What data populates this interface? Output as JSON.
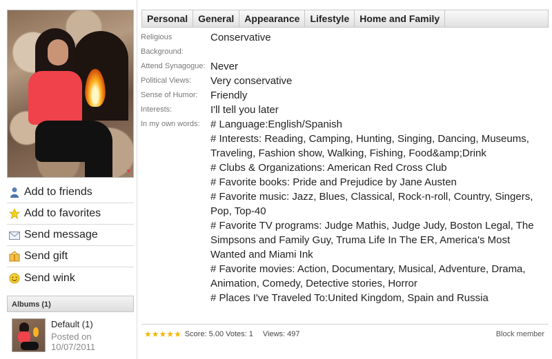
{
  "actions": [
    {
      "label": "Add to friends",
      "icon": "user-icon"
    },
    {
      "label": "Add to favorites",
      "icon": "star-icon"
    },
    {
      "label": "Send message",
      "icon": "envelope-icon"
    },
    {
      "label": "Send gift",
      "icon": "gift-icon"
    },
    {
      "label": "Send wink",
      "icon": "smiley-icon"
    }
  ],
  "albums": {
    "header": "Albums (1)",
    "items": [
      {
        "name": "Default (1)",
        "posted": "Posted on 10/07/2011"
      }
    ]
  },
  "tabs": [
    "Personal",
    "General",
    "Appearance",
    "Lifestyle",
    "Home and Family"
  ],
  "details": [
    {
      "label": "Religious Background:",
      "value": "Conservative"
    },
    {
      "label": "Attend Synagogue:",
      "value": "Never"
    },
    {
      "label": "Political Views:",
      "value": "Very conservative"
    },
    {
      "label": "Sense of Humor:",
      "value": "Friendly"
    },
    {
      "label": "Interests:",
      "value": "I'll tell you later"
    }
  ],
  "own_words": {
    "label": "In my own words:",
    "lines": [
      "# Language:English/Spanish",
      "# Interests: Reading, Camping, Hunting, Singing, Dancing, Museums, Traveling, Fashion show, Walking, Fishing, Food&amp;Drink",
      "# Clubs & Organizations: American Red Cross Club",
      "# Favorite books: Pride and Prejudice by Jane Austen",
      "# Favorite music: Jazz, Blues, Classical, Rock-n-roll, Country, Singers, Pop, Top-40",
      "# Favorite TV programs: Judge Mathis, Judge Judy, Boston Legal, The Simpsons and Family Guy, Truma Life In The ER, America's Most Wanted and Miami Ink",
      "# Favorite movies: Action, Documentary, Musical, Adventure, Drama, Animation, Comedy, Detective stories, Horror",
      "# Places I've Traveled To:United Kingdom, Spain and Russia"
    ]
  },
  "footer": {
    "rating_stars": 5,
    "score_text": "Score: 5.00 Votes: 1",
    "views_text": "Views: 497",
    "block_label": "Block member"
  }
}
